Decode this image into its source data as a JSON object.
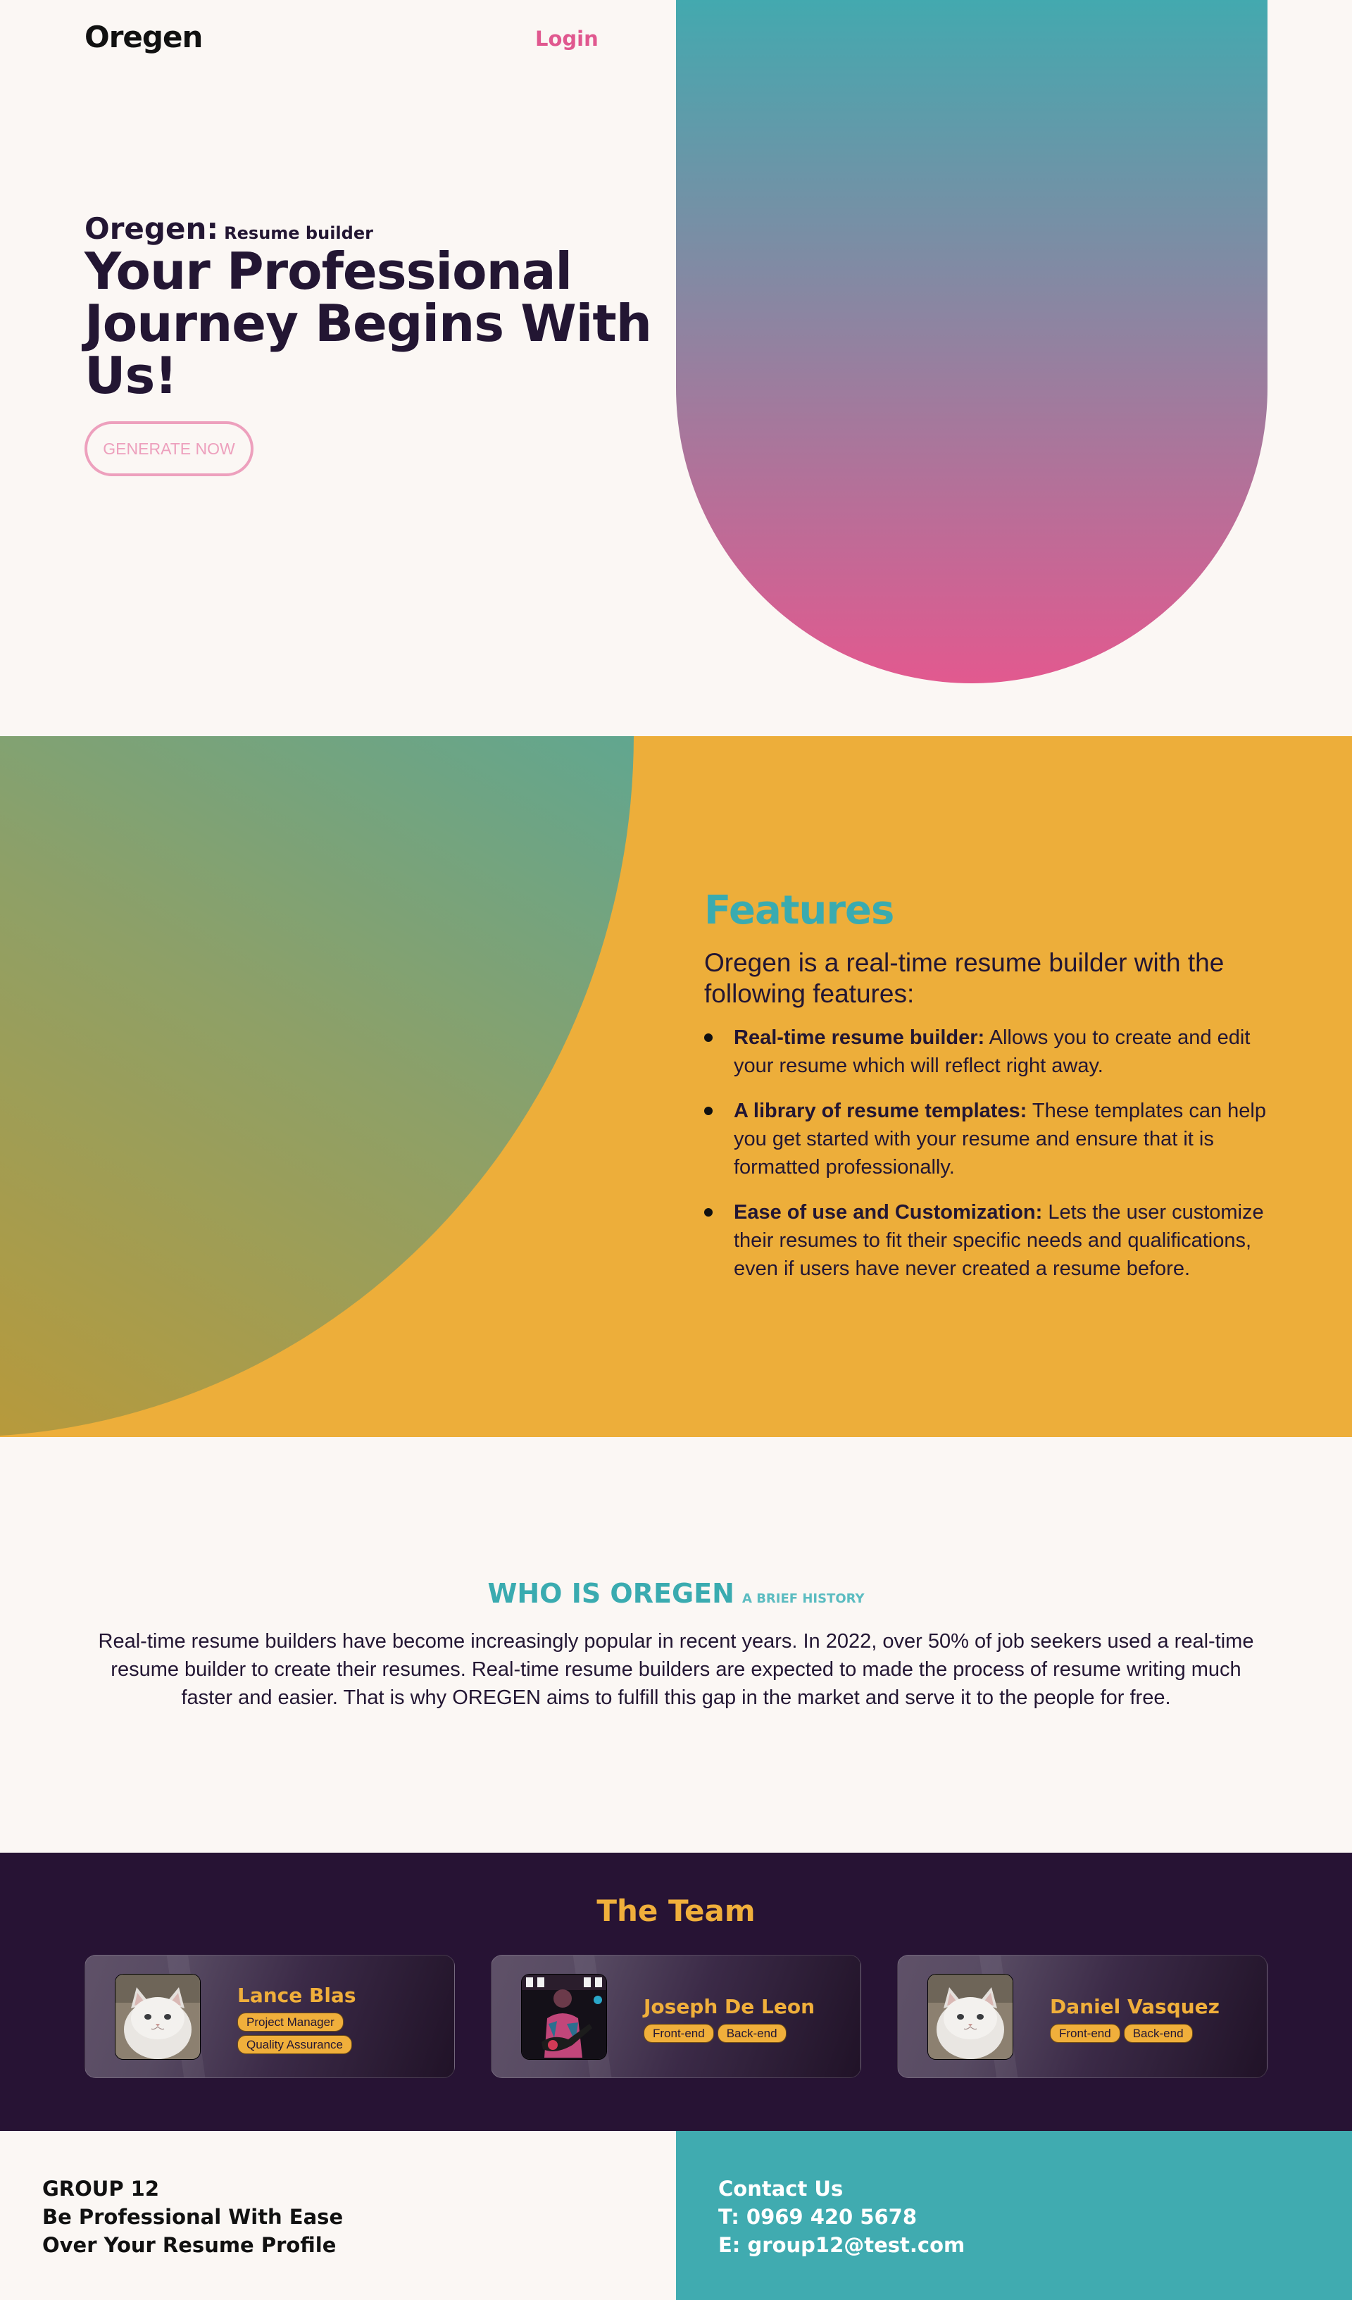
{
  "header": {
    "logo": "Oregen",
    "login_label": "Login"
  },
  "hero": {
    "brand": "Oregen:",
    "tagline": "Resume builder",
    "title": "Your Professional Journey Begins With Us!",
    "cta_label": "GENERATE NOW",
    "gradient_colors": [
      "#43a9af",
      "#e2598f"
    ]
  },
  "features": {
    "title": "Features",
    "intro": "Oregen is a real-time resume builder with the following features:",
    "items": [
      {
        "label": "Real-time resume builder:",
        "text": " Allows you to create and edit your resume which will reflect right away."
      },
      {
        "label": "A library of resume templates:",
        "text": " These templates can help you get started with your resume and ensure that it is formatted professionally."
      },
      {
        "label": "Ease of use and Customization:",
        "text": " Lets the user customize their resumes to fit their specific needs and qualifications, even if users have never created a resume before."
      }
    ],
    "background_color": "#edae3a"
  },
  "about": {
    "heading": "WHO IS OREGEN",
    "subheading": "A BRIEF HISTORY",
    "text": "Real-time resume builders have become increasingly popular in recent years. In 2022, over 50% of job seekers used a real-time resume builder to create their resumes. Real-time resume builders are expected to made the process of resume writing much faster and easier. That is why OREGEN aims to fulfill this gap in the market and serve it to the people for free."
  },
  "team": {
    "title": "The Team",
    "members": [
      {
        "name": "Lance Blas",
        "roles": [
          "Project Manager",
          "Quality Assurance"
        ],
        "avatar": "cat-photo"
      },
      {
        "name": "Joseph De Leon",
        "roles": [
          "Front-end",
          "Back-end"
        ],
        "avatar": "guitarist-photo"
      },
      {
        "name": "Daniel Vasquez",
        "roles": [
          "Front-end",
          "Back-end"
        ],
        "avatar": "cat-photo"
      }
    ],
    "background_color": "#271334",
    "accent_color": "#f0af3b"
  },
  "footer": {
    "left": {
      "line1": "GROUP 12",
      "line2": "Be Professional With Ease",
      "line3": "Over Your Resume Profile"
    },
    "right": {
      "line1": "Contact Us",
      "line2": "T: 0969 420 5678",
      "line3": "E: group12@test.com"
    },
    "right_background": "#40abb0"
  }
}
